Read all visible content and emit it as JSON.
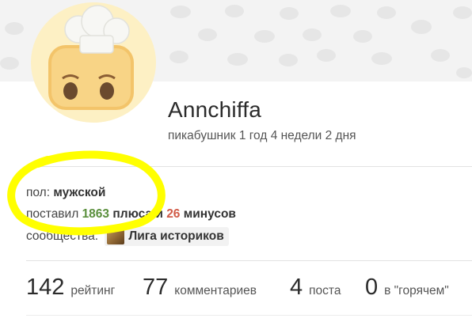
{
  "profile": {
    "username": "Annchiffa",
    "member_since": "пикабушник 1 год 4 недели 2 дня",
    "avatar_icon": "chef-toast-avatar",
    "gender_label": "пол:",
    "gender_value": "мужской",
    "votes_prefix": "поставил",
    "pluses_count": "1863",
    "pluses_word": "плюса и",
    "minuses_count": "26",
    "minuses_word": "минусов",
    "communities_label": "сообщества:",
    "community_name": "Лига историков",
    "community_icon": "history-league-icon"
  },
  "stats": [
    {
      "value": "142",
      "label": "рейтинг"
    },
    {
      "value": "77",
      "label": "комментариев"
    },
    {
      "value": "4",
      "label": "поста"
    },
    {
      "value": "0",
      "label": "в \"горячем\""
    }
  ],
  "colors": {
    "pluses": "#5a8f3c",
    "minuses": "#d15b47",
    "highlight": "#ffff00"
  }
}
